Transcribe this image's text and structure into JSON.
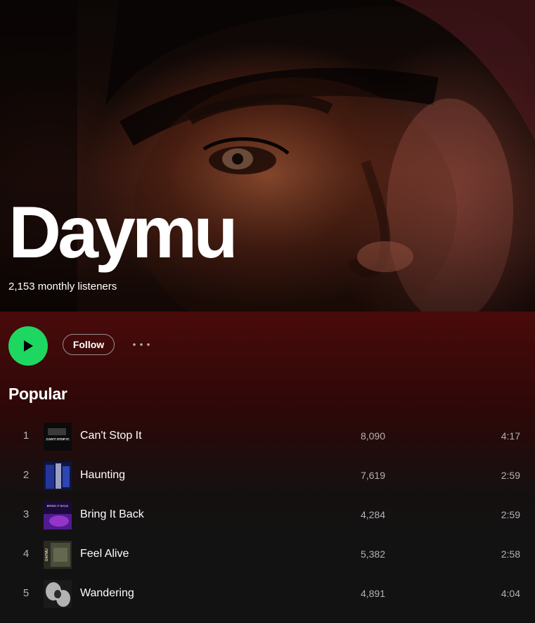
{
  "artist": {
    "name": "Daymu",
    "monthly_listeners": "2,153 monthly listeners"
  },
  "actions": {
    "play_icon": "play-icon",
    "follow_label": "Follow",
    "more_icon": "more-options-icon"
  },
  "popular": {
    "title": "Popular",
    "tracks": [
      {
        "number": "1",
        "title": "Can't Stop It",
        "plays": "8,090",
        "duration": "4:17",
        "cover_text": "CAN'T STOP IT"
      },
      {
        "number": "2",
        "title": "Haunting",
        "plays": "7,619",
        "duration": "2:59"
      },
      {
        "number": "3",
        "title": "Bring It Back",
        "plays": "4,284",
        "duration": "2:59",
        "cover_text": "BRING IT BACK"
      },
      {
        "number": "4",
        "title": "Feel Alive",
        "plays": "5,382",
        "duration": "2:58",
        "cover_text": "DAYMU"
      },
      {
        "number": "5",
        "title": "Wandering",
        "plays": "4,891",
        "duration": "4:04"
      }
    ]
  },
  "colors": {
    "accent_green": "#1ed760",
    "background": "#121212",
    "header_red": "#4a0a0a",
    "secondary_text": "#b3b3b3"
  }
}
